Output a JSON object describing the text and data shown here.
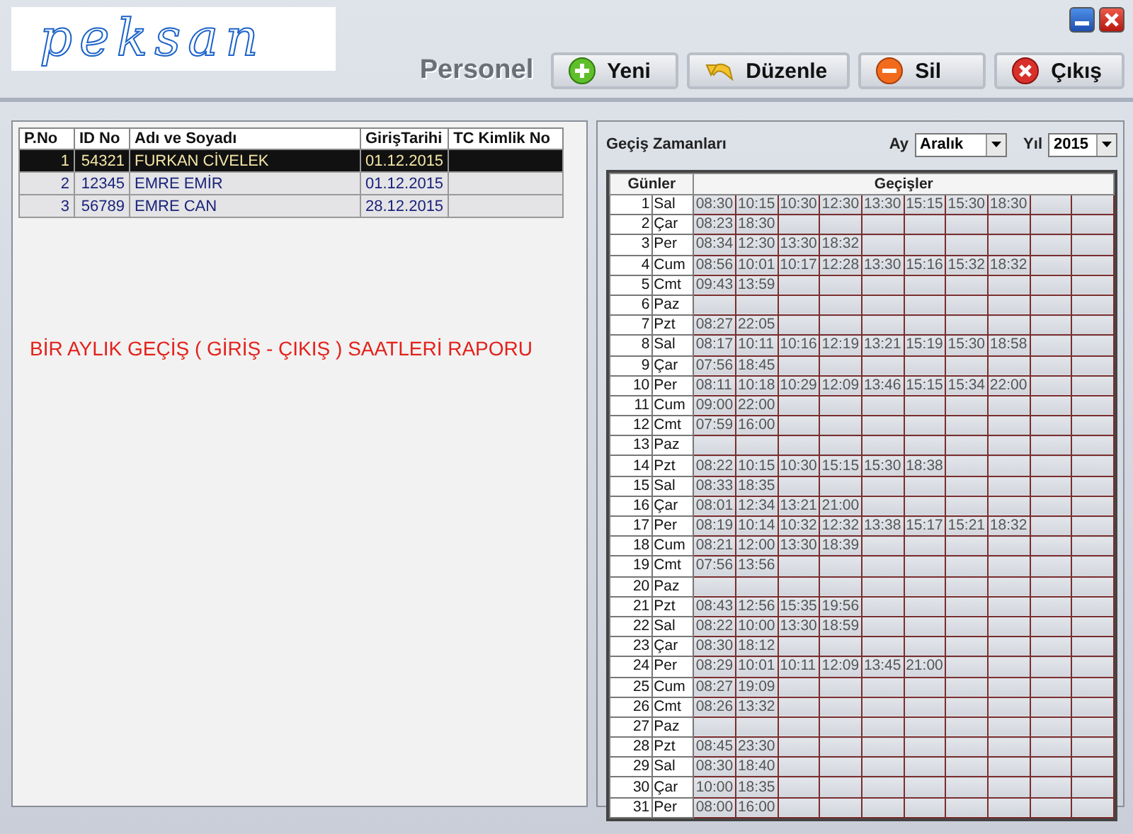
{
  "logo": "peksan",
  "window_controls": [
    {
      "kind": "minimize"
    },
    {
      "kind": "close"
    }
  ],
  "section_title": "Personel",
  "buttons": [
    {
      "label": "Yeni",
      "kind": "add"
    },
    {
      "label": "Düzenle",
      "kind": "edit"
    },
    {
      "label": "Sil",
      "kind": "delete"
    },
    {
      "label": "Çıkış",
      "kind": "exit"
    }
  ],
  "personnel_table": {
    "columns": [
      "P.No",
      "ID No",
      "Adı ve Soyadı",
      "GirişTarihi",
      "TC Kimlik No"
    ],
    "rows": [
      {
        "p_no": "1",
        "id_no": "54321",
        "name": "FURKAN CİVELEK",
        "date": "01.12.2015",
        "selected": true
      },
      {
        "p_no": "2",
        "id_no": "12345",
        "name": "EMRE  EMİR",
        "date": "01.12.2015",
        "selected": false
      },
      {
        "p_no": "3",
        "id_no": "56789",
        "name": "EMRE CAN",
        "date": "28.12.2015",
        "selected": false
      }
    ]
  },
  "report_title": "BİR AYLIK GEÇİŞ ( GİRİŞ - ÇIKIŞ ) SAATLERİ RAPORU",
  "passages": {
    "title": "Geçiş Zamanları",
    "month_label": "Ay",
    "month": "Aralık",
    "year_label": "Yıl",
    "year": "2015",
    "columns": [
      "Günler",
      "Geçişler"
    ],
    "days": [
      {
        "n": "1",
        "day": "Sal",
        "times": [
          "08:30",
          "10:15",
          "10:30",
          "12:30",
          "13:30",
          "15:15",
          "15:30",
          "18:30"
        ]
      },
      {
        "n": "2",
        "day": "Çar",
        "times": [
          "08:23",
          "18:30"
        ]
      },
      {
        "n": "3",
        "day": "Per",
        "times": [
          "08:34",
          "12:30",
          "13:30",
          "18:32"
        ]
      },
      {
        "n": "4",
        "day": "Cum",
        "times": [
          "08:56",
          "10:01",
          "10:17",
          "12:28",
          "13:30",
          "15:16",
          "15:32",
          "18:32"
        ]
      },
      {
        "n": "5",
        "day": "Cmt",
        "times": [
          "09:43",
          "13:59"
        ]
      },
      {
        "n": "6",
        "day": "Paz"
      },
      {
        "n": "7",
        "day": "Pzt",
        "times": [
          "08:27",
          "22:05"
        ]
      },
      {
        "n": "8",
        "day": "Sal",
        "times": [
          "08:17",
          "10:11",
          "10:16",
          "12:19",
          "13:21",
          "15:19",
          "15:30",
          "18:58"
        ]
      },
      {
        "n": "9",
        "day": "Çar",
        "times": [
          "07:56",
          "18:45"
        ]
      },
      {
        "n": "10",
        "day": "Per",
        "times": [
          "08:11",
          "10:18",
          "10:29",
          "12:09",
          "13:46",
          "15:15",
          "15:34",
          "22:00"
        ]
      },
      {
        "n": "11",
        "day": "Cum",
        "times": [
          "09:00",
          "22:00"
        ]
      },
      {
        "n": "12",
        "day": "Cmt",
        "times": [
          "07:59",
          "16:00"
        ]
      },
      {
        "n": "13",
        "day": "Paz"
      },
      {
        "n": "14",
        "day": "Pzt",
        "times": [
          "08:22",
          "10:15",
          "10:30",
          "15:15",
          "15:30",
          "18:38"
        ]
      },
      {
        "n": "15",
        "day": "Sal",
        "times": [
          "08:33",
          "18:35"
        ]
      },
      {
        "n": "16",
        "day": "Çar",
        "times": [
          "08:01",
          "12:34",
          "13:21",
          "21:00"
        ]
      },
      {
        "n": "17",
        "day": "Per",
        "times": [
          "08:19",
          "10:14",
          "10:32",
          "12:32",
          "13:38",
          "15:17",
          "15:21",
          "18:32"
        ]
      },
      {
        "n": "18",
        "day": "Cum",
        "times": [
          "08:21",
          "12:00",
          "13:30",
          "18:39"
        ]
      },
      {
        "n": "19",
        "day": "Cmt",
        "times": [
          "07:56",
          "13:56"
        ]
      },
      {
        "n": "20",
        "day": "Paz"
      },
      {
        "n": "21",
        "day": "Pzt",
        "times": [
          "08:43",
          "12:56",
          "15:35",
          "19:56"
        ]
      },
      {
        "n": "22",
        "day": "Sal",
        "times": [
          "08:22",
          "10:00",
          "13:30",
          "18:59"
        ]
      },
      {
        "n": "23",
        "day": "Çar",
        "times": [
          "08:30",
          "18:12"
        ]
      },
      {
        "n": "24",
        "day": "Per",
        "times": [
          "08:29",
          "10:01",
          "10:11",
          "12:09",
          "13:45",
          "21:00"
        ]
      },
      {
        "n": "25",
        "day": "Cum",
        "times": [
          "08:27",
          "19:09"
        ]
      },
      {
        "n": "26",
        "day": "Cmt",
        "times": [
          "08:26",
          "13:32"
        ]
      },
      {
        "n": "27",
        "day": "Paz"
      },
      {
        "n": "28",
        "day": "Pzt",
        "times": [
          "08:45",
          "23:30"
        ]
      },
      {
        "n": "29",
        "day": "Sal",
        "times": [
          "08:30",
          "18:40"
        ]
      },
      {
        "n": "30",
        "day": "Çar",
        "times": [
          "10:00",
          "18:35"
        ]
      },
      {
        "n": "31",
        "day": "Per",
        "times": [
          "08:00",
          "16:00"
        ]
      }
    ]
  }
}
